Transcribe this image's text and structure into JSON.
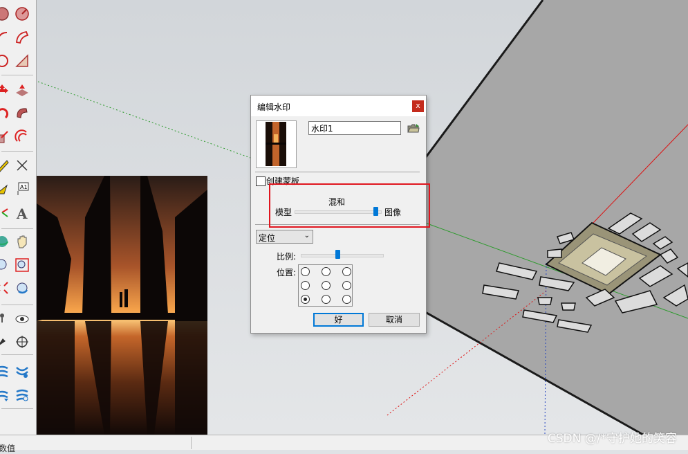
{
  "dialog": {
    "title": "编辑水印",
    "close_label": "x",
    "name_value": "水印1",
    "create_mask_label": "创建蒙板",
    "create_mask_checked": false,
    "blend": {
      "title": "混和",
      "left_label": "模型",
      "right_label": "图像",
      "value": 1.0
    },
    "mode_select": {
      "value": "定位"
    },
    "scale": {
      "label": "比例:",
      "value": 0.45
    },
    "position": {
      "label": "位置:",
      "selected": "bottom-left"
    },
    "ok_label": "好",
    "cancel_label": "取消"
  },
  "status_bar": {
    "text": "数值"
  },
  "watermark_text": "CSDN @/*守护她的笑容",
  "colors": {
    "accent": "#0078d7",
    "close": "#c42b1c",
    "highlight_box": "#e0151e"
  },
  "toolbar_icons": [
    "arc-icon",
    "pie-icon",
    "arc2-icon",
    "freehand-icon",
    "circle-icon",
    "polygon-icon",
    "move-icon",
    "pushpull-icon",
    "rotate-icon",
    "followme-icon",
    "scale-icon",
    "offset-icon",
    "tape-icon",
    "dimension-icon",
    "protractor-icon",
    "text-icon",
    "axes-icon",
    "3dtext-icon",
    "orbit-icon",
    "pan-icon",
    "zoom-icon",
    "zoomwindow-icon",
    "zoomextents-icon",
    "previous-icon",
    "walk-icon",
    "lookaround-icon",
    "section-icon",
    "position-camera-icon",
    "sandbox-icon",
    "sandbox2-icon",
    "sandbox3-icon",
    "sandbox4-icon"
  ]
}
